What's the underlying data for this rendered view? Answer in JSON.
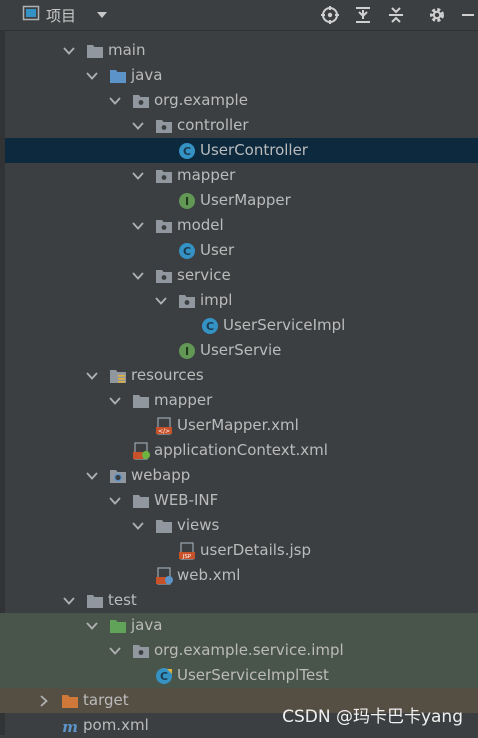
{
  "header": {
    "title": "项目"
  },
  "tree": [
    {
      "label": "main",
      "depth": 0,
      "arrow": "down",
      "icon": "folder-gray"
    },
    {
      "label": "java",
      "depth": 1,
      "arrow": "down",
      "icon": "folder-blue"
    },
    {
      "label": "org.example",
      "depth": 2,
      "arrow": "down",
      "icon": "package"
    },
    {
      "label": "controller",
      "depth": 3,
      "arrow": "down",
      "icon": "package"
    },
    {
      "label": "UserController",
      "depth": 4,
      "arrow": "none",
      "icon": "class-c",
      "selected": true
    },
    {
      "label": "mapper",
      "depth": 3,
      "arrow": "down",
      "icon": "package"
    },
    {
      "label": "UserMapper",
      "depth": 4,
      "arrow": "none",
      "icon": "interface-i"
    },
    {
      "label": "model",
      "depth": 3,
      "arrow": "down",
      "icon": "package"
    },
    {
      "label": "User",
      "depth": 4,
      "arrow": "none",
      "icon": "class-c"
    },
    {
      "label": "service",
      "depth": 3,
      "arrow": "down",
      "icon": "package"
    },
    {
      "label": "impl",
      "depth": 4,
      "arrow": "down",
      "icon": "package"
    },
    {
      "label": "UserServiceImpl",
      "depth": 5,
      "arrow": "none",
      "icon": "class-c"
    },
    {
      "label": "UserServie",
      "depth": 4,
      "arrow": "none",
      "icon": "interface-i"
    },
    {
      "label": "resources",
      "depth": 1,
      "arrow": "down",
      "icon": "folder-resources"
    },
    {
      "label": "mapper",
      "depth": 2,
      "arrow": "down",
      "icon": "folder-gray"
    },
    {
      "label": "UserMapper.xml",
      "depth": 3,
      "arrow": "none",
      "icon": "xml-file"
    },
    {
      "label": "applicationContext.xml",
      "depth": 2,
      "arrow": "none",
      "icon": "spring-xml"
    },
    {
      "label": "webapp",
      "depth": 1,
      "arrow": "down",
      "icon": "folder-web"
    },
    {
      "label": "WEB-INF",
      "depth": 2,
      "arrow": "down",
      "icon": "folder-gray"
    },
    {
      "label": "views",
      "depth": 3,
      "arrow": "down",
      "icon": "folder-gray"
    },
    {
      "label": "userDetails.jsp",
      "depth": 4,
      "arrow": "none",
      "icon": "jsp-file"
    },
    {
      "label": "web.xml",
      "depth": 3,
      "arrow": "none",
      "icon": "webxml-file"
    },
    {
      "label": "test",
      "depth": 0,
      "arrow": "down",
      "icon": "folder-gray"
    },
    {
      "label": "java",
      "depth": 1,
      "arrow": "down",
      "icon": "folder-green",
      "highlight": "test"
    },
    {
      "label": "org.example.service.impl",
      "depth": 2,
      "arrow": "down",
      "icon": "package",
      "highlight": "test"
    },
    {
      "label": "UserServiceImplTest",
      "depth": 3,
      "arrow": "none",
      "icon": "test-class",
      "highlight": "test"
    },
    {
      "label": "target",
      "depth": -1,
      "arrow": "right",
      "icon": "folder-orange",
      "highlight": "excluded"
    },
    {
      "label": "pom.xml",
      "depth": -1,
      "arrow": "none",
      "icon": "maven-file"
    }
  ],
  "watermark": "CSDN @玛卡巴卡yang",
  "colors": {
    "background": "#3c3f41",
    "selection": "#0d293e",
    "test_highlight": "#49544a",
    "excluded_highlight": "#554e43",
    "class_icon": "#3592c4",
    "interface_icon": "#629755",
    "text": "#bbbbbb"
  }
}
